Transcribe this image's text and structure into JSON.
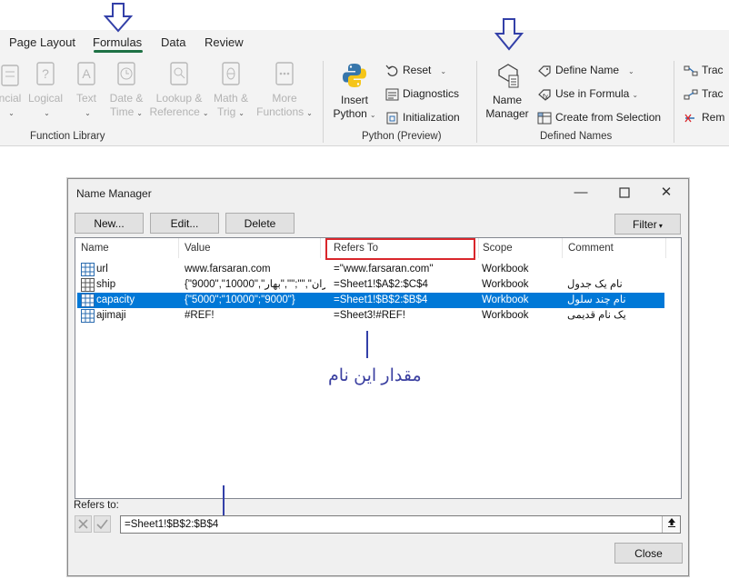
{
  "tabs": [
    "Page Layout",
    "Formulas",
    "Data",
    "Review"
  ],
  "active_tab": "Formulas",
  "function_library": {
    "label": "Function Library",
    "buttons": [
      {
        "l1": "ncial",
        "l2": ""
      },
      {
        "l1": "Logical",
        "l2": ""
      },
      {
        "l1": "Text",
        "l2": ""
      },
      {
        "l1": "Date &",
        "l2": "Time"
      },
      {
        "l1": "Lookup &",
        "l2": "Reference"
      },
      {
        "l1": "Math &",
        "l2": "Trig"
      },
      {
        "l1": "More",
        "l2": "Functions"
      }
    ]
  },
  "python": {
    "label": "Python (Preview)",
    "insert_l1": "Insert",
    "insert_l2": "Python",
    "reset": "Reset",
    "diagnostics": "Diagnostics",
    "initialization": "Initialization"
  },
  "defined_names": {
    "label": "Defined Names",
    "name_manager_l1": "Name",
    "name_manager_l2": "Manager",
    "define_name": "Define Name",
    "use_in_formula": "Use in Formula",
    "create_from_selection": "Create from Selection"
  },
  "auditing": {
    "trace1": "Trac",
    "trace2": "Trac",
    "remove": "Rem"
  },
  "dialog": {
    "title": "Name Manager",
    "new_label": "New...",
    "edit_label": "Edit...",
    "delete_label": "Delete",
    "filter_label": "Filter",
    "columns": [
      "Name",
      "Value",
      "Refers To",
      "Scope",
      "Comment"
    ],
    "rows": [
      {
        "name": "url",
        "value": "www.farsaran.com",
        "refers": "=\"www.farsaran.com\"",
        "scope": "Workbook",
        "comment": "",
        "selected": false
      },
      {
        "name": "ship",
        "value": "{\"9000\",\"10000\",\"تران\",\"\";\"\",\"بهار...",
        "refers": "=Sheet1!$A$2:$C$4",
        "scope": "Workbook",
        "comment": "نام یک جدول",
        "selected": false
      },
      {
        "name": "capacity",
        "value": "{\"5000\";\"10000\";\"9000\"}",
        "refers": "=Sheet1!$B$2:$B$4",
        "scope": "Workbook",
        "comment": "نام چند سلول",
        "selected": true
      },
      {
        "name": "ajimaji",
        "value": "#REF!",
        "refers": "=Sheet3!#REF!",
        "scope": "Workbook",
        "comment": "یک نام قدیمی",
        "selected": false
      }
    ],
    "refers_to_label": "Refers to:",
    "refers_to_value": "=Sheet1!$B$2:$B$4",
    "close_label": "Close"
  },
  "annotation_text": "مقدار این نام",
  "colors": {
    "accent_green": "#1e7145",
    "selection_blue": "#0078d7",
    "annotation_blue": "#3a3fa0",
    "highlight_red": "#d9262b"
  }
}
